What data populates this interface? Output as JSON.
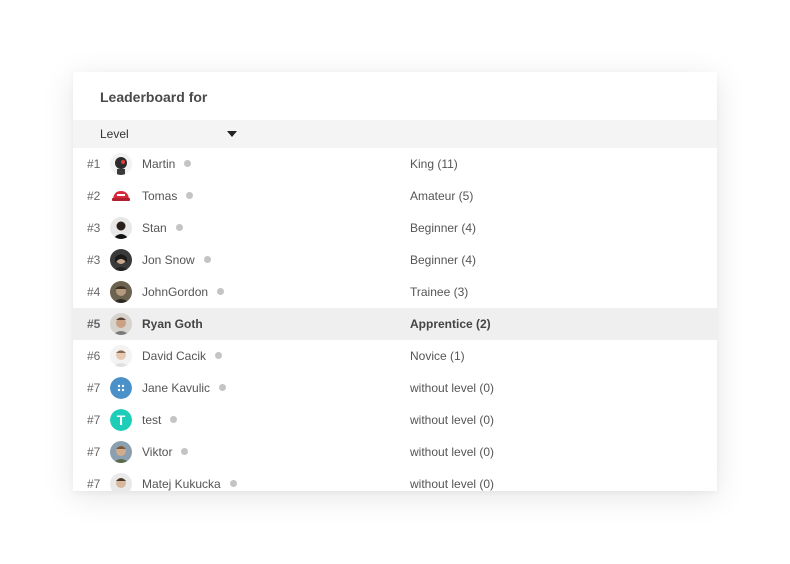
{
  "header": {
    "title": "Leaderboard for"
  },
  "filter": {
    "selected": "Level"
  },
  "status_dot_color": "#c4c4c4",
  "highlight_color": "#efefef",
  "rows": [
    {
      "rank": "#1",
      "name": "Martin",
      "level": "King (11)",
      "avatar": "robot-avatar-icon",
      "online_dot": true
    },
    {
      "rank": "#2",
      "name": "Tomas",
      "level": "Amateur (5)",
      "avatar": "red-cap-avatar-icon",
      "online_dot": true
    },
    {
      "rank": "#3",
      "name": "Stan",
      "level": "Beginner (4)",
      "avatar": "person-photo-avatar",
      "online_dot": true
    },
    {
      "rank": "#3",
      "name": "Jon Snow",
      "level": "Beginner (4)",
      "avatar": "person-photo-avatar",
      "online_dot": true
    },
    {
      "rank": "#4",
      "name": "JohnGordon",
      "level": "Trainee (3)",
      "avatar": "person-photo-avatar",
      "online_dot": true
    },
    {
      "rank": "#5",
      "name": "Ryan Goth",
      "level": "Apprentice (2)",
      "avatar": "person-photo-avatar",
      "online_dot": false,
      "highlighted": true
    },
    {
      "rank": "#6",
      "name": "David Cacik",
      "level": "Novice (1)",
      "avatar": "person-photo-avatar",
      "online_dot": true
    },
    {
      "rank": "#7",
      "name": "Jane Kavulic",
      "level": "without level (0)",
      "avatar": "dots-avatar-icon",
      "online_dot": true
    },
    {
      "rank": "#7",
      "name": "test",
      "level": "without level (0)",
      "avatar": "T",
      "online_dot": true
    },
    {
      "rank": "#7",
      "name": "Viktor",
      "level": "without level (0)",
      "avatar": "person-photo-avatar",
      "online_dot": true
    },
    {
      "rank": "#7",
      "name": "Matej Kukucka",
      "level": "without level (0)",
      "avatar": "person-photo-avatar",
      "online_dot": true
    }
  ]
}
